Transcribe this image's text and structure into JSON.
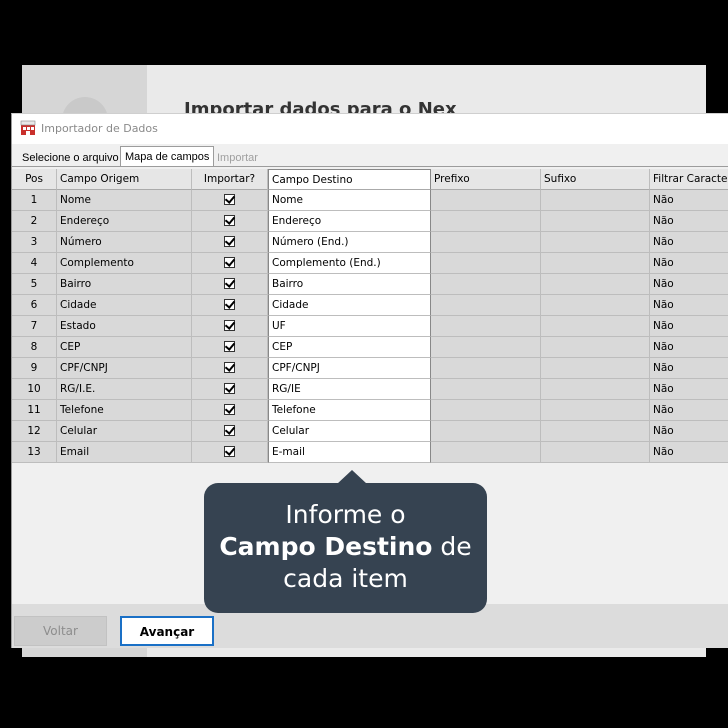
{
  "background": {
    "title": "Importar dados para o Nex"
  },
  "dialog": {
    "title": "Importador de Dados",
    "tabs": [
      {
        "label": "Selecione o arquivo"
      },
      {
        "label": "Mapa de campos"
      },
      {
        "label": "Importar"
      }
    ],
    "active_tab": "Mapa de campos"
  },
  "grid": {
    "headers": {
      "pos": "Pos",
      "origem": "Campo Origem",
      "importar": "Importar?",
      "destino": "Campo Destino",
      "prefixo": "Prefixo",
      "sufixo": "Sufixo",
      "filtrar": "Filtrar Caracteres"
    },
    "rows": [
      {
        "pos": "1",
        "origem": "Nome",
        "importar": true,
        "destino": "Nome",
        "prefixo": "",
        "sufixo": "",
        "filtrar": "Não"
      },
      {
        "pos": "2",
        "origem": "Endereço",
        "importar": true,
        "destino": "Endereço",
        "prefixo": "",
        "sufixo": "",
        "filtrar": "Não"
      },
      {
        "pos": "3",
        "origem": "Número",
        "importar": true,
        "destino": "Número (End.)",
        "prefixo": "",
        "sufixo": "",
        "filtrar": "Não"
      },
      {
        "pos": "4",
        "origem": "Complemento",
        "importar": true,
        "destino": "Complemento (End.)",
        "prefixo": "",
        "sufixo": "",
        "filtrar": "Não"
      },
      {
        "pos": "5",
        "origem": "Bairro",
        "importar": true,
        "destino": "Bairro",
        "prefixo": "",
        "sufixo": "",
        "filtrar": "Não"
      },
      {
        "pos": "6",
        "origem": "Cidade",
        "importar": true,
        "destino": "Cidade",
        "prefixo": "",
        "sufixo": "",
        "filtrar": "Não"
      },
      {
        "pos": "7",
        "origem": "Estado",
        "importar": true,
        "destino": "UF",
        "prefixo": "",
        "sufixo": "",
        "filtrar": "Não"
      },
      {
        "pos": "8",
        "origem": "CEP",
        "importar": true,
        "destino": "CEP",
        "prefixo": "",
        "sufixo": "",
        "filtrar": "Não"
      },
      {
        "pos": "9",
        "origem": "CPF/CNPJ",
        "importar": true,
        "destino": "CPF/CNPJ",
        "prefixo": "",
        "sufixo": "",
        "filtrar": "Não"
      },
      {
        "pos": "10",
        "origem": "RG/I.E.",
        "importar": true,
        "destino": "RG/IE",
        "prefixo": "",
        "sufixo": "",
        "filtrar": "Não"
      },
      {
        "pos": "11",
        "origem": "Telefone",
        "importar": true,
        "destino": "Telefone",
        "prefixo": "",
        "sufixo": "",
        "filtrar": "Não"
      },
      {
        "pos": "12",
        "origem": "Celular",
        "importar": true,
        "destino": "Celular",
        "prefixo": "",
        "sufixo": "",
        "filtrar": "Não"
      },
      {
        "pos": "13",
        "origem": "Email",
        "importar": true,
        "destino": "E-mail",
        "prefixo": "",
        "sufixo": "",
        "filtrar": "Não"
      }
    ]
  },
  "buttons": {
    "back": "Voltar",
    "next": "Avançar"
  },
  "callout": {
    "line1": "Informe o",
    "bold": "Campo Destino",
    "line2_rest": " de",
    "line3": "cada item"
  },
  "colors": {
    "callout_bg": "#364351",
    "accent": "#1a70c6"
  },
  "icons": {
    "app": "app-icon"
  }
}
